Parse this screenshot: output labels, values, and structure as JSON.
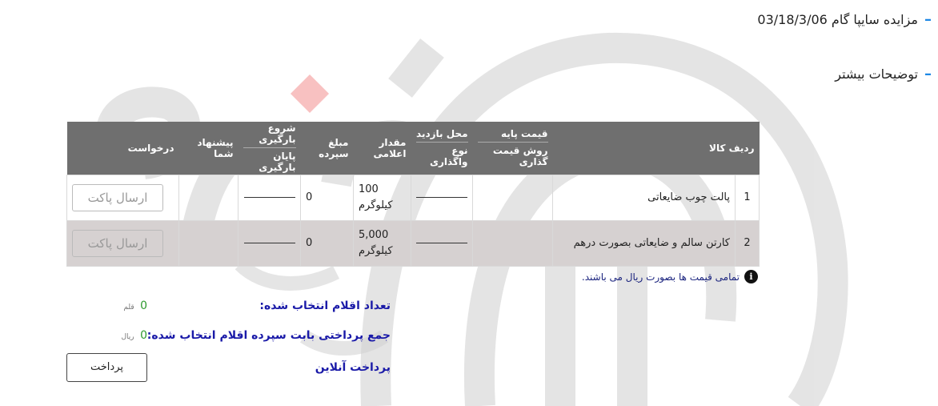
{
  "auction_title": "مزایده سایپا گام 03/18/3/06",
  "more_details": "توضیحات بیشتر",
  "table": {
    "headers": {
      "row_item": "ردیف کالا",
      "base_price": "قیمت پایه",
      "pricing_method": "روش قیمت گذاری",
      "visit_place": "محل بازدید",
      "assignment_type": "نوع واگذاری",
      "announced_qty": "مقدار اعلامی",
      "deposit_amount": "مبلغ سپرده",
      "loading_start": "شروع بارگیری",
      "loading_end": "پایان بارگیری",
      "your_offer": "پیشنهاد شما",
      "request": "درخواست"
    },
    "rows": [
      {
        "num": "1",
        "name": "پالت چوب ضایعاتی",
        "qty": "100",
        "unit": "کیلوگرم",
        "deposit": "0",
        "action": "ارسال پاکت"
      },
      {
        "num": "2",
        "name": "کارتن سالم و ضایعاتی بصورت درهم",
        "qty": "5,000",
        "unit": "کیلوگرم",
        "deposit": "0",
        "action": "ارسال پاکت"
      }
    ]
  },
  "note": "تمامی قیمت ها بصورت ریال می باشند.",
  "summary": {
    "selected_count_label": "تعداد اقلام انتخاب شده:",
    "selected_count_value": "0",
    "selected_count_unit": "قلم",
    "deposit_sum_label": "جمع پرداختی بابت سپرده اقلام انتخاب شده:",
    "deposit_sum_value": "0",
    "deposit_sum_unit": "ریال",
    "online_payment": "پرداخت آنلاین",
    "pay_button": "پرداخت"
  },
  "colors": {
    "header_bg": "#6f6f6f",
    "accent": "#1e88e5",
    "summary_text": "#1a1aa8",
    "count_green": "#2e9a2e"
  }
}
